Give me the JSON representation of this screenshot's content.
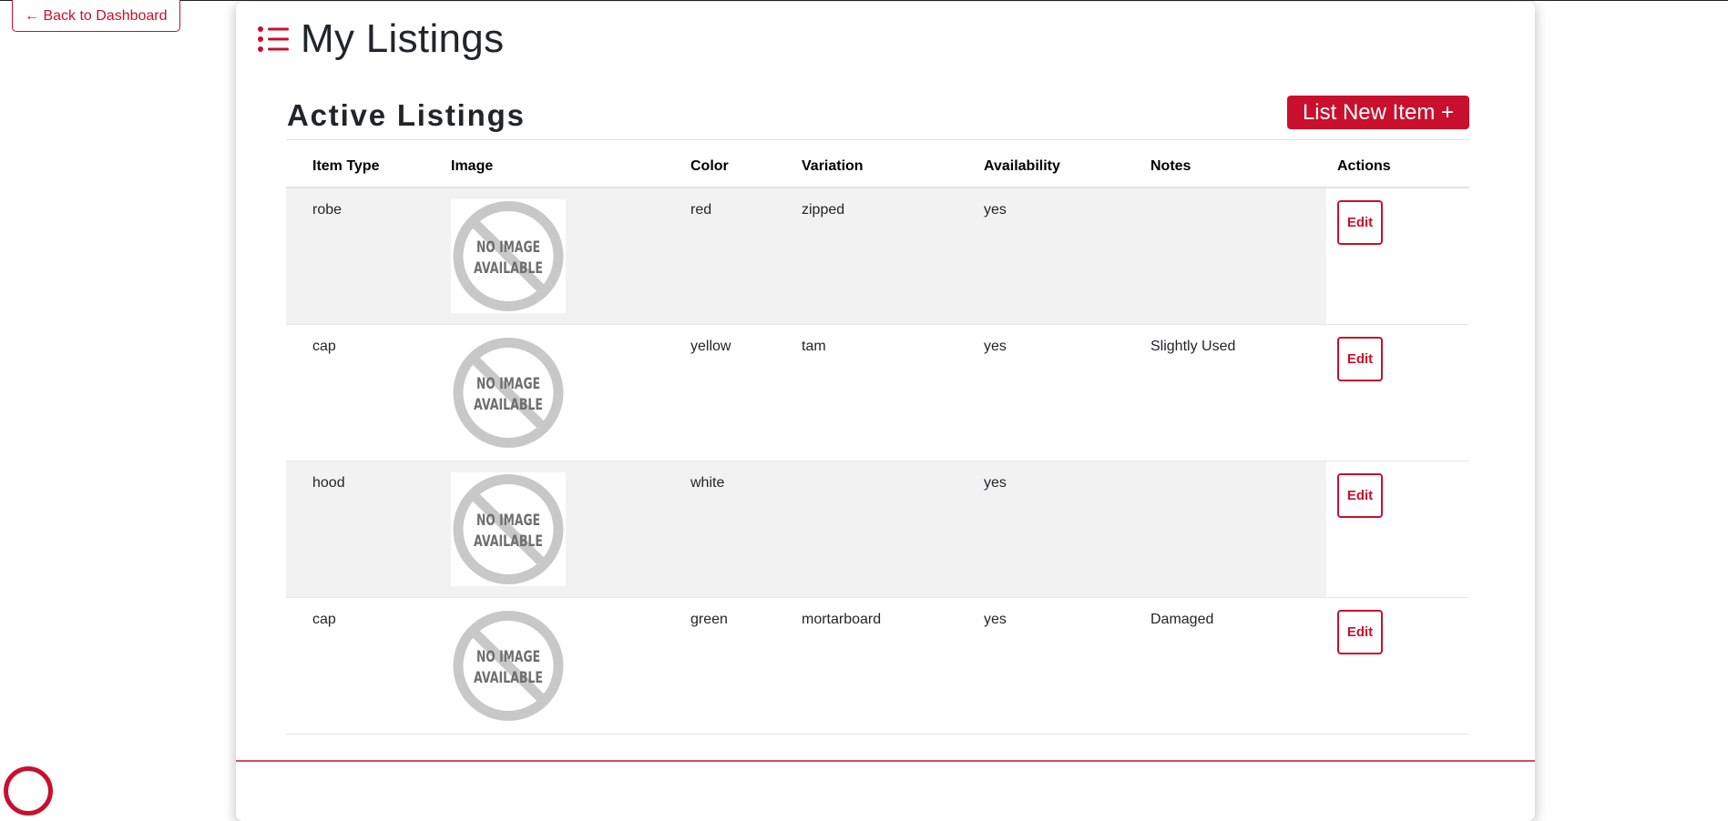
{
  "nav": {
    "back_label": "← Back to Dashboard"
  },
  "page": {
    "title": "My Listings"
  },
  "section": {
    "title": "Active Listings",
    "new_button_label": "List New Item +"
  },
  "table": {
    "headers": [
      "Item Type",
      "Image",
      "Color",
      "Variation",
      "Availability",
      "Notes",
      "Actions"
    ],
    "rows": [
      {
        "item_type": "robe",
        "image_text": [
          "NO IMAGE",
          "AVAILABLE"
        ],
        "color": "red",
        "variation": "zipped",
        "availability": "yes",
        "notes": "",
        "action": "Edit"
      },
      {
        "item_type": "cap",
        "image_text": [
          "NO IMAGE",
          "AVAILABLE"
        ],
        "color": "yellow",
        "variation": "tam",
        "availability": "yes",
        "notes": "Slightly Used",
        "action": "Edit"
      },
      {
        "item_type": "hood",
        "image_text": [
          "NO IMAGE",
          "AVAILABLE"
        ],
        "color": "white",
        "variation": "",
        "availability": "yes",
        "notes": "",
        "action": "Edit"
      },
      {
        "item_type": "cap",
        "image_text": [
          "NO IMAGE",
          "AVAILABLE"
        ],
        "color": "green",
        "variation": "mortarboard",
        "availability": "yes",
        "notes": "Damaged",
        "action": "Edit"
      }
    ]
  },
  "icons": {
    "title_icon": "list-icon",
    "placeholder_icon": "no-image-placeholder-icon",
    "help_icon": "help-circle-icon"
  },
  "colors": {
    "brand": "#c8102e",
    "stripe": "#f2f2f2",
    "placeholder_gray": "#c8c8c8",
    "placeholder_text": "#6e6e6e"
  }
}
